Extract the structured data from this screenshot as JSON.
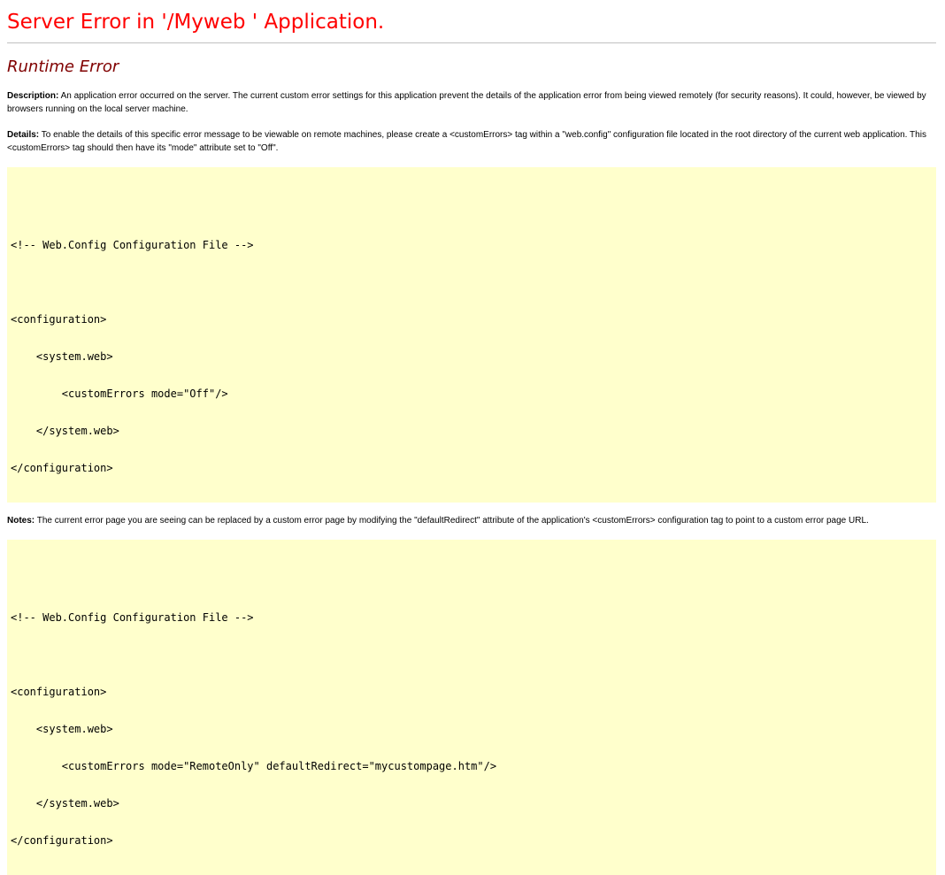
{
  "header": {
    "title": "Server Error in '/Myweb  ' Application.",
    "subtitle": "Runtime Error"
  },
  "description": {
    "label": "Description:",
    "text": " An application error occurred on the server. The current custom error settings for this application prevent the details of the application error from being viewed remotely (for security reasons). It could, however, be viewed by browsers running on the local server machine."
  },
  "details": {
    "label": "Details:",
    "text": " To enable the details of this specific error message to be viewable on remote machines, please create a <customErrors> tag within a \"web.config\" configuration file located in the root directory of the current web application. This <customErrors> tag should then have its \"mode\" attribute set to \"Off\"."
  },
  "code_block_1": {
    "lines": [
      "",
      "<!-- Web.Config Configuration File -->",
      "",
      "<configuration>",
      "    <system.web>",
      "        <customErrors mode=\"Off\"/>",
      "    </system.web>",
      "</configuration>"
    ]
  },
  "notes": {
    "label": "Notes:",
    "text": " The current error page you are seeing can be replaced by a custom error page by modifying the \"defaultRedirect\" attribute of the application's <customErrors> configuration tag to point to a custom error page URL."
  },
  "code_block_2": {
    "lines": [
      "",
      "<!-- Web.Config Configuration File -->",
      "",
      "<configuration>",
      "    <system.web>",
      "        <customErrors mode=\"RemoteOnly\" defaultRedirect=\"mycustompage.htm\"/>",
      "    </system.web>",
      "</configuration>"
    ]
  },
  "colors": {
    "title": "#ff0000",
    "subtitle": "#800000",
    "code_background": "#ffffcc",
    "rule": "#c0c0c0"
  }
}
